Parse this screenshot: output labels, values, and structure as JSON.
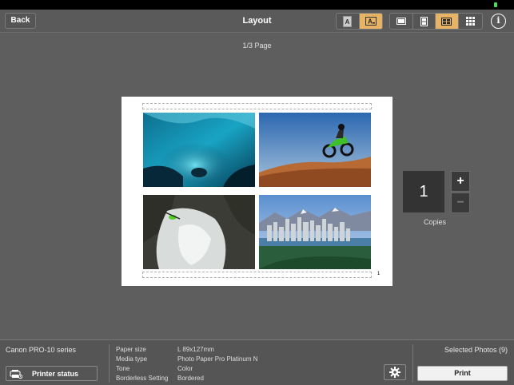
{
  "nav": {
    "back_label": "Back",
    "title": "Layout",
    "info_symbol": "i",
    "text_toggle": [
      {
        "name": "text-outline-icon",
        "active": false
      },
      {
        "name": "text-filled-icon",
        "active": true
      }
    ],
    "layout_toggle": [
      {
        "name": "layout-1-icon",
        "active": false
      },
      {
        "name": "layout-2-icon",
        "active": false
      },
      {
        "name": "layout-4-icon",
        "active": true
      },
      {
        "name": "layout-9-icon",
        "active": false
      }
    ]
  },
  "preview": {
    "page_indicator": "1/3 Page",
    "page_number": "1",
    "photos": [
      {
        "name": "photo-ice-cave",
        "description_icon": "image-icon"
      },
      {
        "name": "photo-motocross",
        "description_icon": "image-icon"
      },
      {
        "name": "photo-kayak-waterfall",
        "description_icon": "image-icon"
      },
      {
        "name": "photo-city-skyline",
        "description_icon": "image-icon"
      }
    ]
  },
  "copies": {
    "value": "1",
    "plus": "+",
    "minus": "−",
    "label": "Copies"
  },
  "bottom": {
    "printer_name": "Canon PRO-10 series",
    "printer_status_label": "Printer status",
    "settings": [
      {
        "key": "Paper size",
        "value": "L 89x127mm"
      },
      {
        "key": "Media type",
        "value": "Photo Paper Pro Platinum N"
      },
      {
        "key": "Tone",
        "value": "Color"
      },
      {
        "key": "Borderless Setting",
        "value": "Bordered"
      }
    ],
    "selected_photos": "Selected Photos (9)",
    "print_label": "Print"
  },
  "colors": {
    "accent": "#e7b466",
    "background": "#5e5e5e"
  }
}
